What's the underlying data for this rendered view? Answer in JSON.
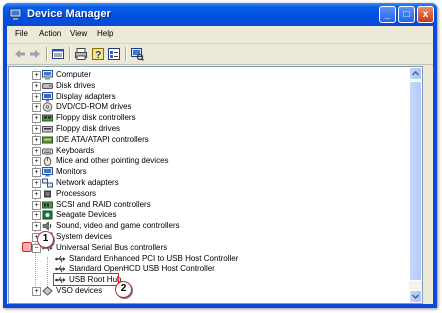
{
  "window": {
    "title": "Device Manager",
    "minimize_label": "_",
    "maximize_label": "□",
    "close_label": "x"
  },
  "menu": [
    "File",
    "Action",
    "View",
    "Help"
  ],
  "toolbar": {
    "buttons": [
      "back-icon",
      "forward-icon",
      "properties-grid-icon",
      "print-icon",
      "help-icon",
      "properties-icon",
      "scan-hardware-icon"
    ]
  },
  "tree": {
    "items": [
      {
        "label": "Computer",
        "state": "collapsed",
        "indent": 0,
        "icon": "computer-icon"
      },
      {
        "label": "Disk drives",
        "state": "collapsed",
        "indent": 0,
        "icon": "disk-drive-icon"
      },
      {
        "label": "Display adapters",
        "state": "collapsed",
        "indent": 0,
        "icon": "display-adapter-icon"
      },
      {
        "label": "DVD/CD-ROM drives",
        "state": "collapsed",
        "indent": 0,
        "icon": "cd-drive-icon"
      },
      {
        "label": "Floppy disk controllers",
        "state": "collapsed",
        "indent": 0,
        "icon": "controller-icon"
      },
      {
        "label": "Floppy disk drives",
        "state": "collapsed",
        "indent": 0,
        "icon": "floppy-icon"
      },
      {
        "label": "IDE ATA/ATAPI controllers",
        "state": "collapsed",
        "indent": 0,
        "icon": "ide-controller-icon"
      },
      {
        "label": "Keyboards",
        "state": "collapsed",
        "indent": 0,
        "icon": "keyboard-icon"
      },
      {
        "label": "Mice and other pointing devices",
        "state": "collapsed",
        "indent": 0,
        "icon": "mouse-icon"
      },
      {
        "label": "Monitors",
        "state": "collapsed",
        "indent": 0,
        "icon": "monitor-icon"
      },
      {
        "label": "Network adapters",
        "state": "collapsed",
        "indent": 0,
        "icon": "network-icon"
      },
      {
        "label": "Processors",
        "state": "collapsed",
        "indent": 0,
        "icon": "processor-icon"
      },
      {
        "label": "SCSI and RAID controllers",
        "state": "collapsed",
        "indent": 0,
        "icon": "scsi-icon"
      },
      {
        "label": "Seagate Devices",
        "state": "collapsed",
        "indent": 0,
        "icon": "seagate-icon"
      },
      {
        "label": "Sound, video and game controllers",
        "state": "collapsed",
        "indent": 0,
        "icon": "sound-icon"
      },
      {
        "label": "System devices",
        "state": "collapsed",
        "indent": 0,
        "icon": "system-icon"
      },
      {
        "label": "Universal Serial Bus controllers",
        "state": "expanded",
        "indent": 0,
        "icon": "usb-icon"
      },
      {
        "label": "Standard Enhanced PCI to USB Host Controller",
        "state": "leaf",
        "indent": 1,
        "icon": "usb-icon"
      },
      {
        "label": "Standard OpenHCD USB Host Controller",
        "state": "leaf",
        "indent": 1,
        "icon": "usb-icon"
      },
      {
        "label": "USB Root Hub",
        "state": "leaf",
        "indent": 1,
        "icon": "usb-icon"
      },
      {
        "label": "VSO devices",
        "state": "collapsed",
        "indent": 0,
        "icon": "vso-icon"
      }
    ]
  },
  "callouts": {
    "one": "1",
    "two": "2"
  },
  "colors": {
    "titlebar": "#0b49d6",
    "callout_border": "#d42020"
  }
}
